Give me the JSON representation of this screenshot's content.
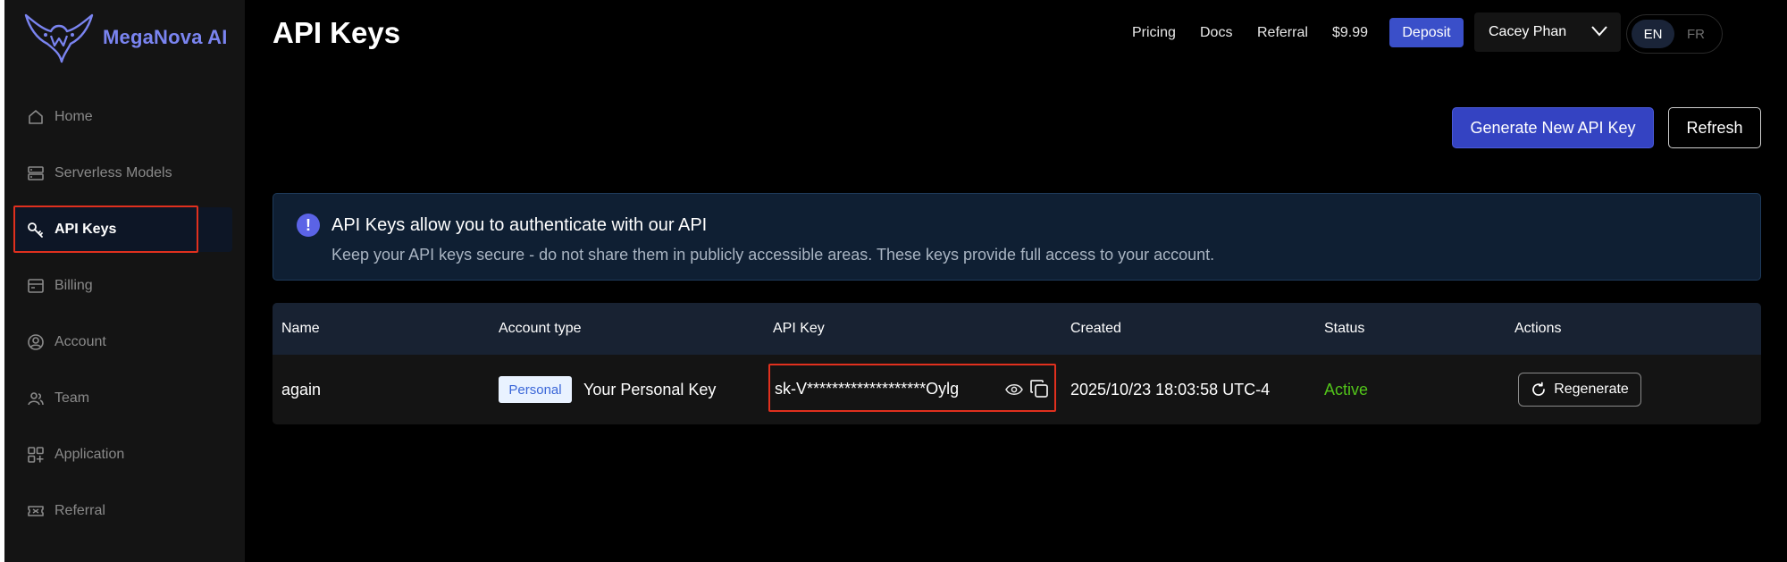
{
  "brand": {
    "name": "MegaNova AI",
    "accent": "#7a84f0"
  },
  "sidebar": {
    "items": [
      {
        "label": "Home",
        "icon": "home-icon"
      },
      {
        "label": "Serverless Models",
        "icon": "server-icon"
      },
      {
        "label": "API Keys",
        "icon": "key-icon",
        "active": true
      },
      {
        "label": "Billing",
        "icon": "billing-icon"
      },
      {
        "label": "Account",
        "icon": "account-icon"
      },
      {
        "label": "Team",
        "icon": "team-icon"
      },
      {
        "label": "Application",
        "icon": "application-icon"
      },
      {
        "label": "Referral",
        "icon": "ticket-icon"
      }
    ]
  },
  "header": {
    "title": "API Keys",
    "links": {
      "pricing": "Pricing",
      "docs": "Docs",
      "referral": "Referral"
    },
    "balance": "$9.99",
    "deposit_label": "Deposit",
    "user_name": "Cacey Phan",
    "languages": {
      "en": "EN",
      "fr": "FR",
      "selected": "EN"
    }
  },
  "actions": {
    "generate_label": "Generate New API Key",
    "refresh_label": "Refresh"
  },
  "alert": {
    "icon": "exclamation-icon",
    "title": "API Keys allow you to authenticate with our API",
    "description": "Keep your API keys secure - do not share them in publicly accessible areas. These keys provide full access to your account."
  },
  "table": {
    "columns": [
      "Name",
      "Account type",
      "API Key",
      "Created",
      "Status",
      "Actions"
    ],
    "rows": [
      {
        "name": "again",
        "account_badge": "Personal",
        "account_label": "Your Personal Key",
        "api_key": "sk-V*******************Oylg",
        "created": "2025/10/23 18:03:58 UTC-4",
        "status": "Active",
        "action_label": "Regenerate"
      }
    ]
  },
  "colors": {
    "background": "#000000",
    "sidebar": "#141414",
    "primary_button": "#3443c2",
    "status_active": "#52c41a",
    "highlight": "#e0301e"
  }
}
